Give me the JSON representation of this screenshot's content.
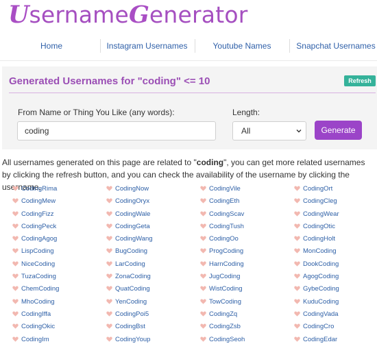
{
  "logo": {
    "u_letter": "U",
    "part1": "sername",
    "g_letter": "G",
    "part2": "enerator"
  },
  "nav": {
    "items": [
      "Home",
      "Instagram Usernames",
      "Youtube Names",
      "Snapchat Usernames"
    ]
  },
  "panel": {
    "title": "Generated Usernames for \"coding\" <= 10",
    "refresh_label": "Refresh",
    "name_label": "From Name or Thing You Like (any words):",
    "name_value": "coding",
    "length_label": "Length:",
    "length_value": "All",
    "generate_label": "Generate"
  },
  "info": {
    "before": "All usernames generated on this page are related to \"",
    "keyword": "coding",
    "after": "\", you can get more related usernames by clicking the refresh button, and you can check the availability of the username by clicking the username."
  },
  "usernames": {
    "col1": [
      "CodingRima",
      "CodingMew",
      "CodingFizz",
      "CodingPeck",
      "CodingAgog",
      "LispCoding",
      "NiceCoding",
      "TuzaCoding",
      "ChemCoding",
      "MhoCoding",
      "CodingIffa",
      "CodingOkic",
      "CodingIm"
    ],
    "col2": [
      "CodingNow",
      "CodingOryx",
      "CodingWale",
      "CodingGeta",
      "CodingWang",
      "BugCoding",
      "LarCoding",
      "ZonaCoding",
      "QuatCoding",
      "YenCoding",
      "CodingPoi5",
      "CodingBst",
      "CodingYoup"
    ],
    "col3": [
      "CodingVile",
      "CodingEth",
      "CodingScav",
      "CodingTush",
      "CodingOo",
      "ProgCoding",
      "HarnCoding",
      "JugCoding",
      "WistCoding",
      "TowCoding",
      "CodingZq",
      "CodingZsb",
      "CodingSeoh"
    ],
    "col4": [
      "CodingOrt",
      "CodingCleg",
      "CodingWear",
      "CodingOtic",
      "CodingHolt",
      "MonCoding",
      "DookCoding",
      "AgogCoding",
      "GybeCoding",
      "KuduCoding",
      "CodingVada",
      "CodingCro",
      "CodingEdar"
    ]
  },
  "colors": {
    "brand_purple": "#a54fc0",
    "link_blue": "#2e5fa8",
    "refresh_green": "#35b29a",
    "generate_purple": "#9b44c8",
    "heart_pink": "#f2b8b0"
  }
}
